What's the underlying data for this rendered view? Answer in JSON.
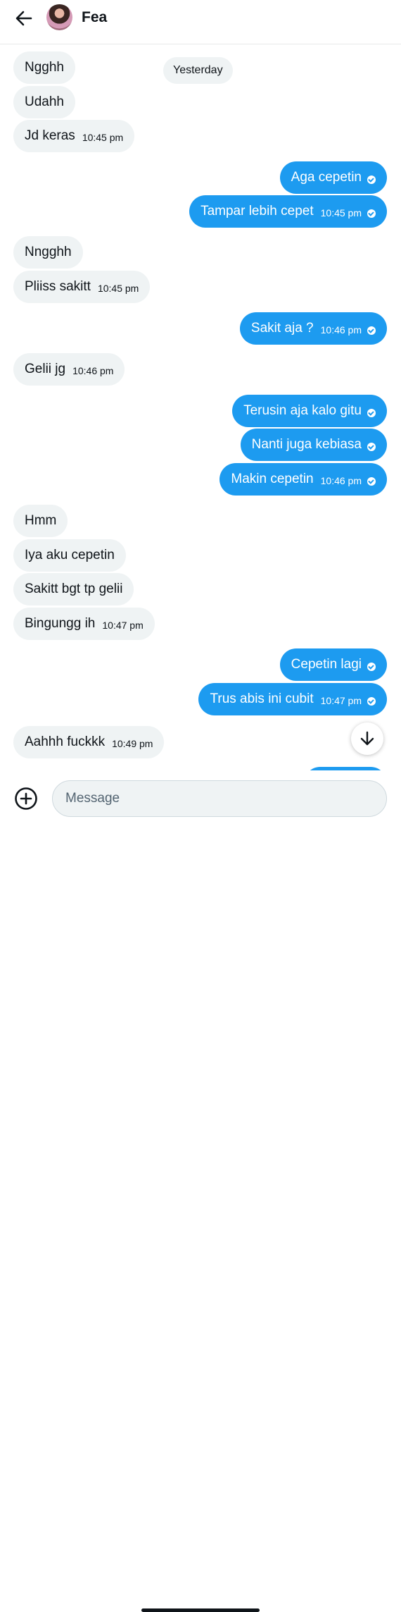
{
  "header": {
    "contact_name": "Fea"
  },
  "date_separator": "Yesterday",
  "messages": [
    {
      "dir": "in",
      "text": "Ngghh",
      "time": ""
    },
    {
      "dir": "in",
      "text": "Udahh",
      "time": ""
    },
    {
      "dir": "in",
      "text": "Jd keras",
      "time": "10:45 pm"
    },
    {
      "dir": "out",
      "text": "Aga cepetin",
      "time": ""
    },
    {
      "dir": "out",
      "text": "Tampar lebih cepet",
      "time": "10:45 pm"
    },
    {
      "dir": "in",
      "text": "Nngghh",
      "time": ""
    },
    {
      "dir": "in",
      "text": "Pliiss sakitt",
      "time": "10:45 pm"
    },
    {
      "dir": "out",
      "text": "Sakit aja ?",
      "time": "10:46 pm"
    },
    {
      "dir": "in",
      "text": "Gelii jg",
      "time": "10:46 pm"
    },
    {
      "dir": "out",
      "text": "Terusin aja kalo gitu",
      "time": ""
    },
    {
      "dir": "out",
      "text": "Nanti juga kebiasa",
      "time": ""
    },
    {
      "dir": "out",
      "text": "Makin cepetin",
      "time": "10:46 pm"
    },
    {
      "dir": "in",
      "text": "Hmm",
      "time": ""
    },
    {
      "dir": "in",
      "text": "Iya aku cepetin",
      "time": ""
    },
    {
      "dir": "in",
      "text": "Sakitt bgt tp gelii",
      "time": ""
    },
    {
      "dir": "in",
      "text": "Bingungg ih",
      "time": "10:47 pm"
    },
    {
      "dir": "out",
      "text": "Cepetin lagi",
      "time": ""
    },
    {
      "dir": "out",
      "text": "Trus abis ini cubit",
      "time": "10:47 pm"
    },
    {
      "dir": "in",
      "text": "Aahhh fuckkk",
      "time": "10:49 pm"
    }
  ],
  "composer": {
    "placeholder": "Message"
  },
  "icons": {
    "back": "arrow-left-icon",
    "add": "plus-circle-icon",
    "scroll": "arrow-down-icon",
    "read": "check-circle-icon"
  },
  "colors": {
    "outgoing": "#1d9bf0",
    "incoming": "#eff3f4"
  }
}
